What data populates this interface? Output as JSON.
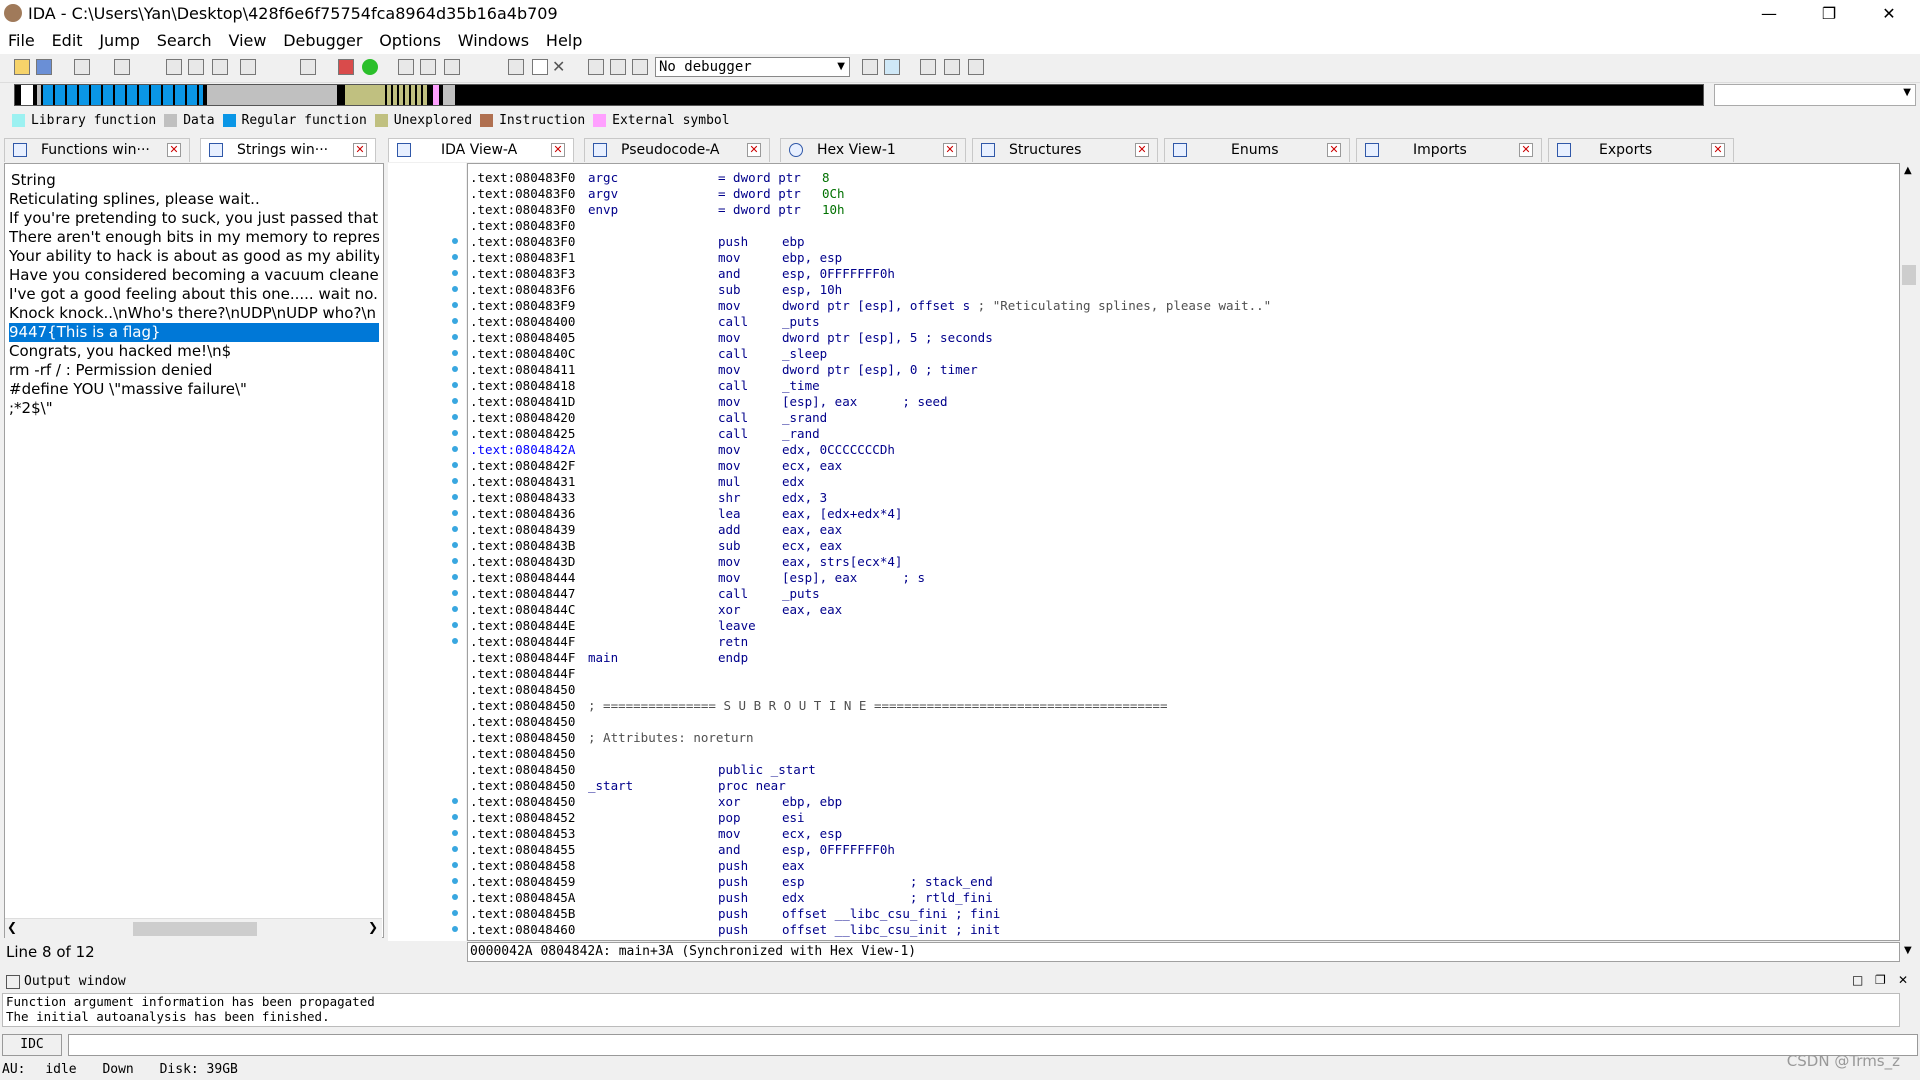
{
  "window": {
    "title": "IDA - C:\\Users\\Yan\\Desktop\\428f6e6f75754fca8964d35b16a4b709",
    "buttons": [
      "—",
      "❐",
      "✕"
    ]
  },
  "menu": [
    "File",
    "Edit",
    "Jump",
    "Search",
    "View",
    "Debugger",
    "Options",
    "Windows",
    "Help"
  ],
  "toolbar": {
    "debugger_select": "No debugger"
  },
  "legend": [
    {
      "label": "Library function",
      "color": "#9cf1f1"
    },
    {
      "label": "Data",
      "color": "#c0c0c0"
    },
    {
      "label": "Regular function",
      "color": "#0a96e6"
    },
    {
      "label": "Unexplored",
      "color": "#c0c080"
    },
    {
      "label": "Instruction",
      "color": "#b07050"
    },
    {
      "label": "External symbol",
      "color": "#ffa0ff"
    }
  ],
  "left_tabs": [
    {
      "label": "Functions win···"
    },
    {
      "label": "Strings win···"
    }
  ],
  "right_tabs": [
    {
      "label": "IDA View-A"
    },
    {
      "label": "Pseudocode-A"
    },
    {
      "label": "Hex View-1"
    },
    {
      "label": "Structures"
    },
    {
      "label": "Enums"
    },
    {
      "label": "Imports"
    },
    {
      "label": "Exports"
    }
  ],
  "strings": {
    "header": "String",
    "rows": [
      "Reticulating splines, please wait..",
      "If you're pretending to suck, you just passed that Tu",
      "There aren't enough bits in my memory to represer",
      "Your ability to hack is about as good as my ability to",
      "Have you considered becoming a vacuum cleaner? ",
      "I've got a good feeling about this one..... wait no. M",
      "Knock knock..\\nWho's there?\\nUDP\\nUDP who?\\n",
      "9447{This  is  a  flag}",
      "Congrats, you hacked me!\\n$",
      "rm -rf / : Permission denied",
      "#define YOU \\\"massive failure\\\"",
      ";*2$\\\""
    ],
    "selected_index": 7,
    "status": "Line 8 of 12"
  },
  "disasm": [
    {
      "addr": ".text:080483F0",
      "label": "argc",
      "mn": "= dword ptr",
      "op": "8",
      "op_num": true
    },
    {
      "addr": ".text:080483F0",
      "label": "argv",
      "mn": "= dword ptr",
      "op": "0Ch",
      "op_num": true
    },
    {
      "addr": ".text:080483F0",
      "label": "envp",
      "mn": "= dword ptr",
      "op": "10h",
      "op_num": true
    },
    {
      "addr": ".text:080483F0"
    },
    {
      "addr": ".text:080483F0",
      "mn": "push",
      "op": "ebp",
      "dot": true
    },
    {
      "addr": ".text:080483F1",
      "mn": "mov",
      "op": "ebp, esp",
      "dot": true
    },
    {
      "addr": ".text:080483F3",
      "mn": "and",
      "op": "esp, 0FFFFFFF0h",
      "dot": true
    },
    {
      "addr": ".text:080483F6",
      "mn": "sub",
      "op": "esp, 10h",
      "dot": true
    },
    {
      "addr": ".text:080483F9",
      "mn": "mov",
      "op": "dword ptr [esp], offset s",
      "cm": " ; \"Reticulating splines, please wait..\"",
      "dot": true
    },
    {
      "addr": ".text:08048400",
      "mn": "call",
      "op": "_puts",
      "dot": true
    },
    {
      "addr": ".text:08048405",
      "mn": "mov",
      "op": "dword ptr [esp], 5",
      "cm": " ; seconds",
      "dot": true
    },
    {
      "addr": ".text:0804840C",
      "mn": "call",
      "op": "_sleep",
      "dot": true
    },
    {
      "addr": ".text:08048411",
      "mn": "mov",
      "op": "dword ptr [esp], 0",
      "cm": " ; timer",
      "dot": true
    },
    {
      "addr": ".text:08048418",
      "mn": "call",
      "op": "_time",
      "dot": true
    },
    {
      "addr": ".text:0804841D",
      "mn": "mov",
      "op": "[esp], eax",
      "cm": "      ; seed",
      "dot": true
    },
    {
      "addr": ".text:08048420",
      "mn": "call",
      "op": "_srand",
      "dot": true
    },
    {
      "addr": ".text:08048425",
      "mn": "call",
      "op": "_rand",
      "dot": true
    },
    {
      "addr": ".text:0804842A",
      "mn": "mov",
      "op": "edx, 0CCCCCCCDh",
      "dot": true,
      "hl": true
    },
    {
      "addr": ".text:0804842F",
      "mn": "mov",
      "op": "ecx, eax",
      "dot": true
    },
    {
      "addr": ".text:08048431",
      "mn": "mul",
      "op": "edx",
      "dot": true
    },
    {
      "addr": ".text:08048433",
      "mn": "shr",
      "op": "edx, 3",
      "dot": true
    },
    {
      "addr": ".text:08048436",
      "mn": "lea",
      "op": "eax, [edx+edx*4]",
      "dot": true
    },
    {
      "addr": ".text:08048439",
      "mn": "add",
      "op": "eax, eax",
      "dot": true
    },
    {
      "addr": ".text:0804843B",
      "mn": "sub",
      "op": "ecx, eax",
      "dot": true
    },
    {
      "addr": ".text:0804843D",
      "mn": "mov",
      "op": "eax, strs[ecx*4]",
      "dot": true
    },
    {
      "addr": ".text:08048444",
      "mn": "mov",
      "op": "[esp], eax",
      "cm": "      ; s",
      "dot": true
    },
    {
      "addr": ".text:08048447",
      "mn": "call",
      "op": "_puts",
      "dot": true
    },
    {
      "addr": ".text:0804844C",
      "mn": "xor",
      "op": "eax, eax",
      "dot": true
    },
    {
      "addr": ".text:0804844E",
      "mn": "leave",
      "op": "",
      "dot": true
    },
    {
      "addr": ".text:0804844F",
      "mn": "retn",
      "op": "",
      "dot": true
    },
    {
      "addr": ".text:0804844F",
      "label": "main",
      "mn": "endp",
      "op": ""
    },
    {
      "addr": ".text:0804844F"
    },
    {
      "addr": ".text:08048450"
    },
    {
      "addr": ".text:08048450",
      "raw": "; =============== S U B R O U T I N E ======================================="
    },
    {
      "addr": ".text:08048450"
    },
    {
      "addr": ".text:08048450",
      "raw": "; Attributes: noreturn"
    },
    {
      "addr": ".text:08048450"
    },
    {
      "addr": ".text:08048450",
      "mn": "public _start",
      "op": ""
    },
    {
      "addr": ".text:08048450",
      "label": "_start",
      "mn": "proc near",
      "op": ""
    },
    {
      "addr": ".text:08048450",
      "mn": "xor",
      "op": "ebp, ebp",
      "dot": true
    },
    {
      "addr": ".text:08048452",
      "mn": "pop",
      "op": "esi",
      "dot": true
    },
    {
      "addr": ".text:08048453",
      "mn": "mov",
      "op": "ecx, esp",
      "dot": true
    },
    {
      "addr": ".text:08048455",
      "mn": "and",
      "op": "esp, 0FFFFFFF0h",
      "dot": true
    },
    {
      "addr": ".text:08048458",
      "mn": "push",
      "op": "eax",
      "dot": true
    },
    {
      "addr": ".text:08048459",
      "mn": "push",
      "op": "esp",
      "cm": "              ; stack_end",
      "dot": true
    },
    {
      "addr": ".text:0804845A",
      "mn": "push",
      "op": "edx",
      "cm": "              ; rtld_fini",
      "dot": true
    },
    {
      "addr": ".text:0804845B",
      "mn": "push",
      "op": "offset __libc_csu_fini",
      "cm": " ; fini",
      "dot": true
    },
    {
      "addr": ".text:08048460",
      "mn": "push",
      "op": "offset __libc_csu_init",
      "cm": " ; init",
      "dot": true
    }
  ],
  "ida_status": "0000042A 0804842A: main+3A (Synchronized with Hex View-1)",
  "output": {
    "title": "Output window",
    "lines": [
      "Function argument information has been propagated",
      "The initial autoanalysis has been finished."
    ],
    "idc_label": "IDC"
  },
  "status_bar": {
    "au": "AU:",
    "state": "idle",
    "dir": "Down",
    "disk": "Disk: 39GB"
  },
  "watermark": "CSDN @Trms_z"
}
